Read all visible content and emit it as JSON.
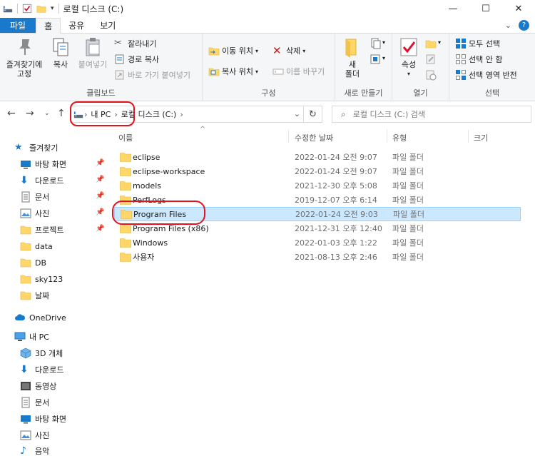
{
  "window": {
    "title": "로컬 디스크 (C:)",
    "controls": {
      "minimize": "—",
      "maximize": "☐",
      "close": "✕"
    }
  },
  "ribbon_tabs": [
    {
      "label": "파일"
    },
    {
      "label": "홈"
    },
    {
      "label": "공유"
    },
    {
      "label": "보기"
    }
  ],
  "ribbon": {
    "clipboard": {
      "label": "클립보드",
      "pin": "즐겨찾기에\n고정",
      "copy": "복사",
      "paste": "붙여넣기",
      "cut": "잘라내기",
      "copy_path": "경로 복사",
      "paste_shortcut": "바로 가기 붙여넣기"
    },
    "organize": {
      "label": "구성",
      "move_to": "이동 위치",
      "copy_to": "복사 위치",
      "delete": "삭제",
      "rename": "이름 바꾸기"
    },
    "new": {
      "label": "새로 만들기",
      "new_folder_line1": "새",
      "new_folder_line2": "폴더"
    },
    "open": {
      "label": "열기",
      "properties": "속성"
    },
    "select": {
      "label": "선택",
      "select_all": "모두 선택",
      "select_none": "선택 안 함",
      "invert": "선택 영역 반전"
    }
  },
  "address": {
    "pc": "내 PC",
    "drive": "로컬 디스크 (C:)",
    "search_placeholder": "로컬 디스크 (C:) 검색"
  },
  "columns": {
    "name": "이름",
    "modified": "수정한 날짜",
    "type": "유형",
    "size": "크기"
  },
  "sidebar": {
    "quick_access": "즐겨찾기",
    "items": [
      {
        "label": "바탕 화면"
      },
      {
        "label": "다운로드"
      },
      {
        "label": "문서"
      },
      {
        "label": "사진"
      },
      {
        "label": "프로젝트"
      },
      {
        "label": "data"
      },
      {
        "label": "DB"
      },
      {
        "label": "sky123"
      },
      {
        "label": "날짜"
      }
    ],
    "onedrive": "OneDrive",
    "this_pc": "내 PC",
    "pc_items": [
      {
        "label": "3D 개체"
      },
      {
        "label": "다운로드"
      },
      {
        "label": "동영상"
      },
      {
        "label": "문서"
      },
      {
        "label": "바탕 화면"
      },
      {
        "label": "사진"
      },
      {
        "label": "음악"
      }
    ]
  },
  "files": [
    {
      "name": "eclipse",
      "date": "2022-01-24 오전 9:07",
      "type": "파일 폴더"
    },
    {
      "name": "eclipse-workspace",
      "date": "2022-01-24 오전 9:07",
      "type": "파일 폴더"
    },
    {
      "name": "models",
      "date": "2021-12-30 오후 5:08",
      "type": "파일 폴더"
    },
    {
      "name": "PerfLogs",
      "date": "2019-12-07 오후 6:14",
      "type": "파일 폴더"
    },
    {
      "name": "Program Files",
      "date": "2022-01-24 오전 9:03",
      "type": "파일 폴더"
    },
    {
      "name": "Program Files (x86)",
      "date": "2021-12-31 오후 12:40",
      "type": "파일 폴더"
    },
    {
      "name": "Windows",
      "date": "2022-01-03 오후 1:22",
      "type": "파일 폴더"
    },
    {
      "name": "사용자",
      "date": "2021-08-13 오후 2:46",
      "type": "파일 폴더"
    }
  ],
  "colors": {
    "accent": "#1979ca",
    "selection": "#cce8ff",
    "folder": "#ffd769",
    "annotation": "#e0141e"
  }
}
